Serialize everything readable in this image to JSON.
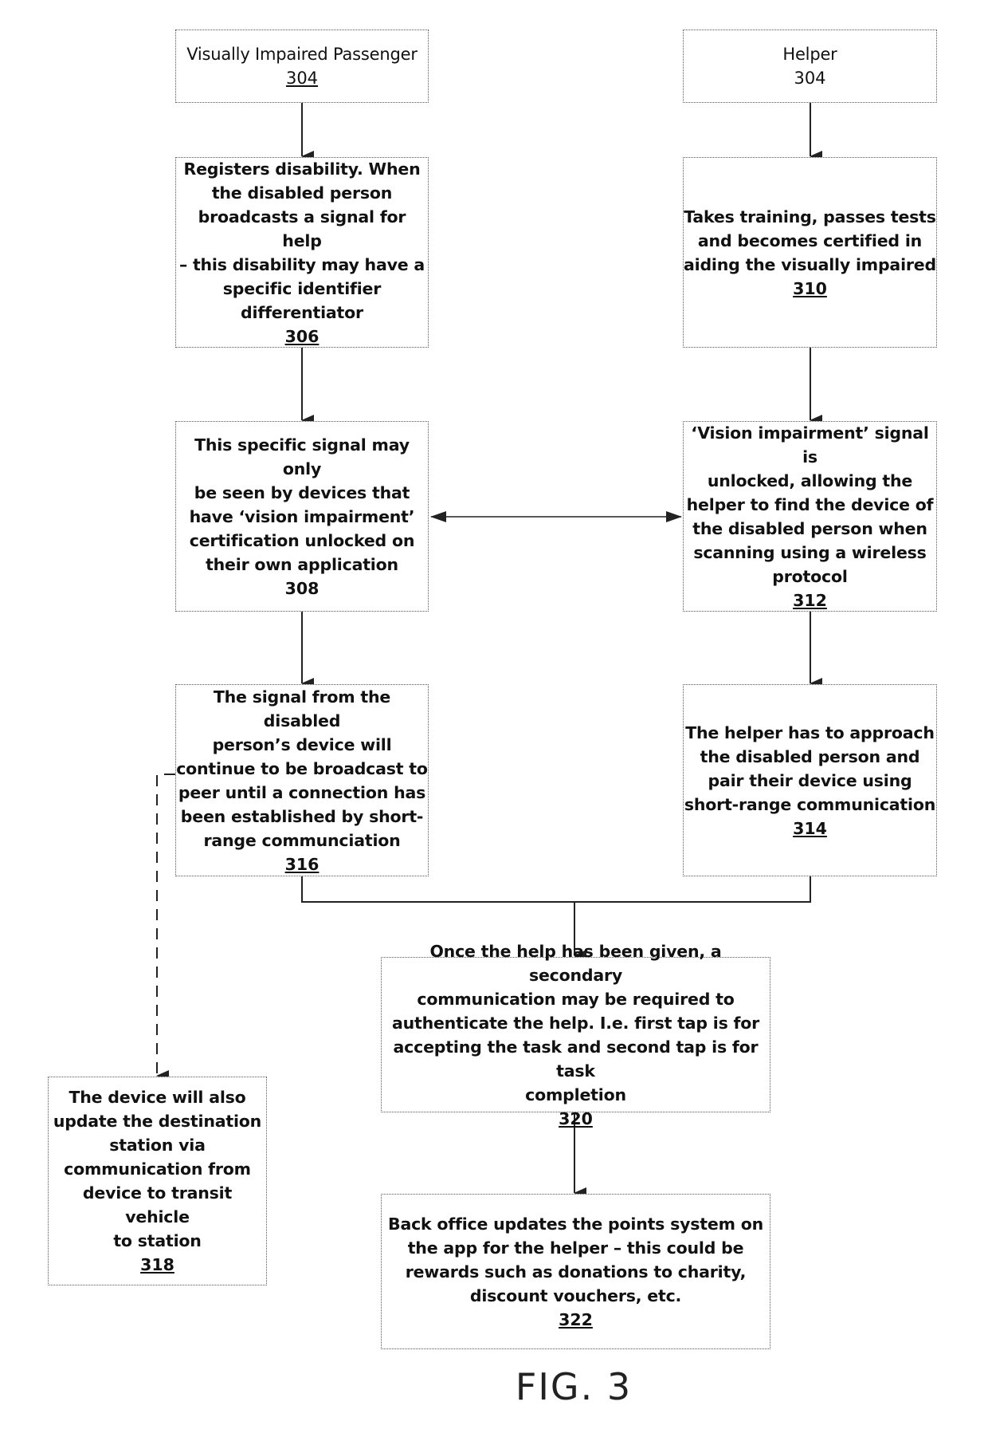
{
  "figure_label": "FIG. 3",
  "nodes": {
    "passenger": {
      "text": "Visually Impaired Passenger",
      "ref": "304"
    },
    "helper": {
      "text": "Helper",
      "ref": "304"
    },
    "n306": {
      "text": "Registers disability.  When\nthe disabled person\nbroadcasts a signal for help\n– this disability may have a\nspecific identifier\ndifferentiator",
      "ref": "306"
    },
    "n310": {
      "text": "Takes training, passes tests\nand becomes certified in\naiding the visually impaired",
      "ref": "310"
    },
    "n308": {
      "text": "This specific signal may only\nbe seen by devices that\nhave ‘vision impairment’\ncertification unlocked on\ntheir own application",
      "ref": "308"
    },
    "n312": {
      "text": "‘Vision impairment’ signal is\nunlocked, allowing the\nhelper to find the device of\nthe disabled person when\nscanning using a wireless\nprotocol",
      "ref": "312"
    },
    "n316": {
      "text": "The signal from the disabled\nperson’s device will\ncontinue to be broadcast to\npeer until a connection has\nbeen established by short-\nrange communciation",
      "ref": "316"
    },
    "n314": {
      "text": "The helper has to approach\nthe disabled person and\npair their device using\nshort-range communication",
      "ref": "314"
    },
    "n318": {
      "text": "The device will also\nupdate the destination\nstation via\ncommunication from\ndevice to transit vehicle\nto station",
      "ref": "318"
    },
    "n320": {
      "text": "Once the help has been given, a secondary\ncommunication may be required to\nauthenticate the help.  I.e. first tap is for\naccepting the task and second tap is for task\ncompletion",
      "ref": "320"
    },
    "n322": {
      "text": "Back office updates the points system on\nthe app for the helper – this could be\nrewards such as donations to charity,\ndiscount vouchers, etc.",
      "ref": "322"
    }
  },
  "edges": [
    {
      "from": "304-passenger",
      "to": "306",
      "style": "solid"
    },
    {
      "from": "306",
      "to": "308",
      "style": "solid"
    },
    {
      "from": "308",
      "to": "316",
      "style": "solid"
    },
    {
      "from": "304-helper",
      "to": "310",
      "style": "solid"
    },
    {
      "from": "310",
      "to": "312",
      "style": "solid"
    },
    {
      "from": "312",
      "to": "314",
      "style": "solid"
    },
    {
      "from": "308",
      "to": "312",
      "style": "bidirectional"
    },
    {
      "from": "316",
      "to": "320",
      "style": "solid-merge"
    },
    {
      "from": "314",
      "to": "320",
      "style": "solid-merge"
    },
    {
      "from": "320",
      "to": "322",
      "style": "solid"
    },
    {
      "from": "316",
      "to": "318",
      "style": "dashed"
    }
  ]
}
